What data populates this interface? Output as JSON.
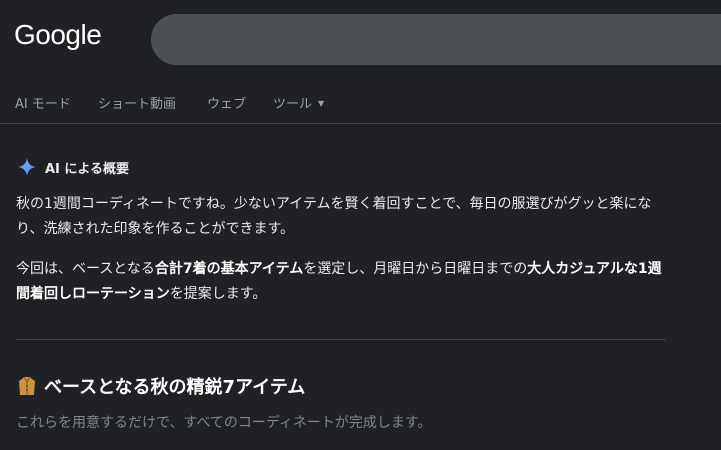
{
  "header": {
    "logo": "Google",
    "search_value": ""
  },
  "tabs": [
    {
      "label": "AI モード"
    },
    {
      "label": "ショート動画"
    },
    {
      "label": "ウェブ"
    },
    {
      "label": "ツール"
    }
  ],
  "ai_overview": {
    "title": "AI による概要",
    "paragraph1": "秋の1週間コーディネートですね。少ないアイテムを賢く着回すことで、毎日の服選びがグッと楽になり、洗練された印象を作ることができます。",
    "paragraph2": {
      "t1": "今回は、ベースとなる",
      "b1": "合計7着の基本アイテム",
      "t2": "を選定し、月曜日から日曜日までの",
      "b2": "大人カジュアルな1週間着回しローテーション",
      "t3": "を提案します。"
    },
    "section": {
      "icon": "coat-icon",
      "title": "ベースとなる秋の精鋭7アイテム",
      "subtitle": "これらを用意するだけで、すべてのコーディネートが完成します。"
    }
  },
  "colors": {
    "background": "#202124",
    "search_box": "#4d5156",
    "accent_spark": "#8ab4f8",
    "muted_text": "#9aa0a6"
  }
}
